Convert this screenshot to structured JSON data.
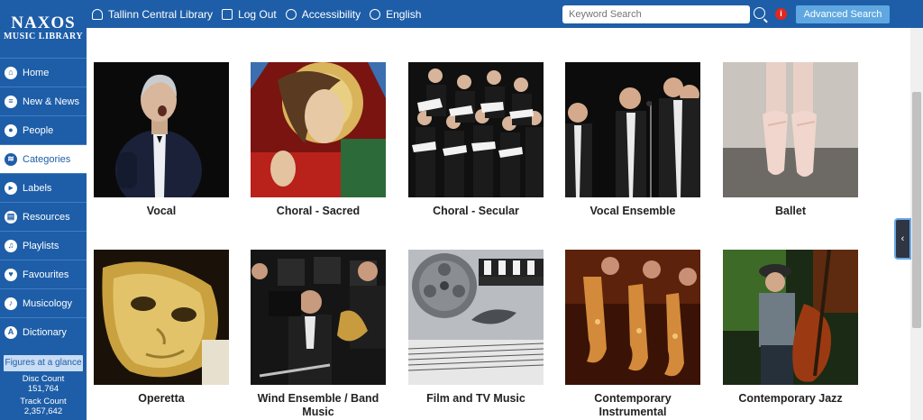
{
  "sidebar": {
    "logo_line1": "NAXOS",
    "logo_line2": "MUSIC LIBRARY",
    "items": [
      {
        "label": "Home",
        "icon": "home-icon"
      },
      {
        "label": "New & News",
        "icon": "news-icon"
      },
      {
        "label": "People",
        "icon": "person-icon"
      },
      {
        "label": "Categories",
        "icon": "categories-icon"
      },
      {
        "label": "Labels",
        "icon": "label-icon"
      },
      {
        "label": "Resources",
        "icon": "resources-icon"
      },
      {
        "label": "Playlists",
        "icon": "playlist-icon"
      },
      {
        "label": "Favourites",
        "icon": "heart-icon"
      },
      {
        "label": "Musicology",
        "icon": "musicology-icon"
      },
      {
        "label": "Dictionary",
        "icon": "dictionary-icon"
      }
    ],
    "active_item": "Categories",
    "figures_label": "Figures at a glance",
    "disc_count_label": "Disc Count",
    "disc_count_value": "151,764",
    "track_count_label": "Track Count",
    "track_count_value": "2,357,642"
  },
  "header": {
    "library": "Tallinn Central Library",
    "logout": "Log Out",
    "accessibility": "Accessibility",
    "language": "English",
    "search_placeholder": "Keyword Search",
    "advanced_search": "Advanced Search",
    "info_glyph": "i"
  },
  "categories": [
    {
      "label": "Vocal",
      "image": "opera-singer-photo"
    },
    {
      "label": "Choral - Sacred",
      "image": "stained-glass-jesus-photo"
    },
    {
      "label": "Choral - Secular",
      "image": "choir-photo"
    },
    {
      "label": "Vocal Ensemble",
      "image": "vocal-ensemble-photo"
    },
    {
      "label": "Ballet",
      "image": "ballet-shoes-photo"
    },
    {
      "label": "Operetta",
      "image": "gold-mask-photo"
    },
    {
      "label": "Wind Ensemble / Band Music",
      "image": "wind-band-photo"
    },
    {
      "label": "Film and TV Music",
      "image": "film-reel-photo"
    },
    {
      "label": "Contemporary Instrumental",
      "image": "saxophones-photo"
    },
    {
      "label": "Contemporary Jazz",
      "image": "jazz-bassist-photo"
    }
  ],
  "collapse_glyph": "‹",
  "colors": {
    "brand_blue": "#1e5ea8",
    "button_blue": "#5fa7e0",
    "info_red": "#e0281c"
  }
}
